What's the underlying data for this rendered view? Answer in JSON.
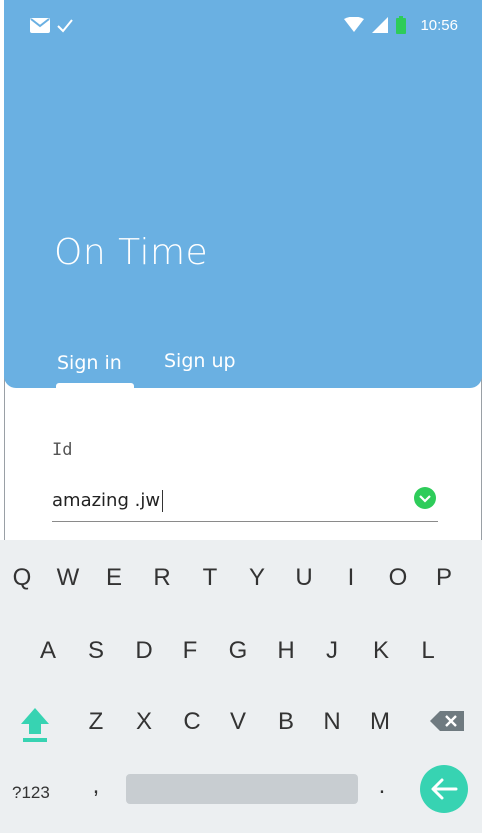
{
  "status_bar": {
    "time": "10:56",
    "left_icons": [
      "mail-icon",
      "check-icon"
    ],
    "right_icons": [
      "wifi-icon",
      "signal-icon",
      "battery-icon"
    ],
    "battery_color": "#2ecc5a"
  },
  "header": {
    "title": "On Time",
    "background": "#6ab0e2"
  },
  "tabs": {
    "signin": "Sign in",
    "signup": "Sign up",
    "selected": "signin"
  },
  "form": {
    "id_label": "Id",
    "id_value": "amazing .jw",
    "valid": true
  },
  "keyboard": {
    "row1": [
      "Q",
      "W",
      "E",
      "R",
      "T",
      "Y",
      "U",
      "I",
      "O",
      "P"
    ],
    "row2": [
      "A",
      "S",
      "D",
      "F",
      "G",
      "H",
      "J",
      "K",
      "L"
    ],
    "row3": [
      "Z",
      "X",
      "C",
      "V",
      "B",
      "N",
      "M"
    ],
    "symbols_key": "?123",
    "comma_key": ",",
    "period_key": ".",
    "accent_color": "#37d3b2"
  }
}
